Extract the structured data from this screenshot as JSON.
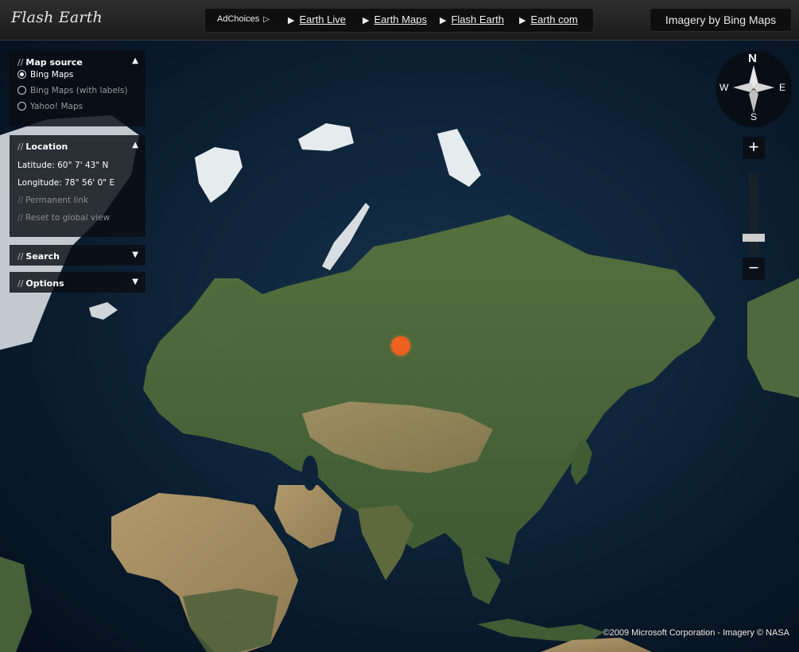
{
  "app": {
    "title": "Flash Earth"
  },
  "nav": {
    "adchoices": "AdChoices",
    "links": [
      {
        "label": "Earth Live"
      },
      {
        "label": "Earth Maps"
      },
      {
        "label": "Flash Earth"
      },
      {
        "label": "Earth com"
      }
    ]
  },
  "imagery_badge": "Imagery by Bing Maps",
  "panels": {
    "map_source": {
      "title": "Map source",
      "options": [
        {
          "label": "Bing Maps",
          "selected": true
        },
        {
          "label": "Bing Maps (with labels)",
          "selected": false
        },
        {
          "label": "Yahoo! Maps",
          "selected": false
        }
      ]
    },
    "location": {
      "title": "Location",
      "latitude": "Latitude: 60° 7' 43\" N",
      "longitude": "Longitude: 78° 56' 0\" E",
      "permanent_link": "Permanent link",
      "reset_view": "Reset to global view"
    },
    "search": {
      "title": "Search"
    },
    "options": {
      "title": "Options"
    }
  },
  "compass": {
    "n": "N",
    "s": "S",
    "e": "E",
    "w": "W"
  },
  "zoom": {
    "in": "+",
    "out": "−",
    "level_fraction": 0.18
  },
  "marker": {
    "color": "#f0601e"
  },
  "copyright": "©2009 Microsoft Corporation - Imagery © NASA",
  "colors": {
    "ocean": "#0d2338",
    "land_green": "#4b6438",
    "land_desert": "#a08a62",
    "ice": "#e8eef2"
  }
}
